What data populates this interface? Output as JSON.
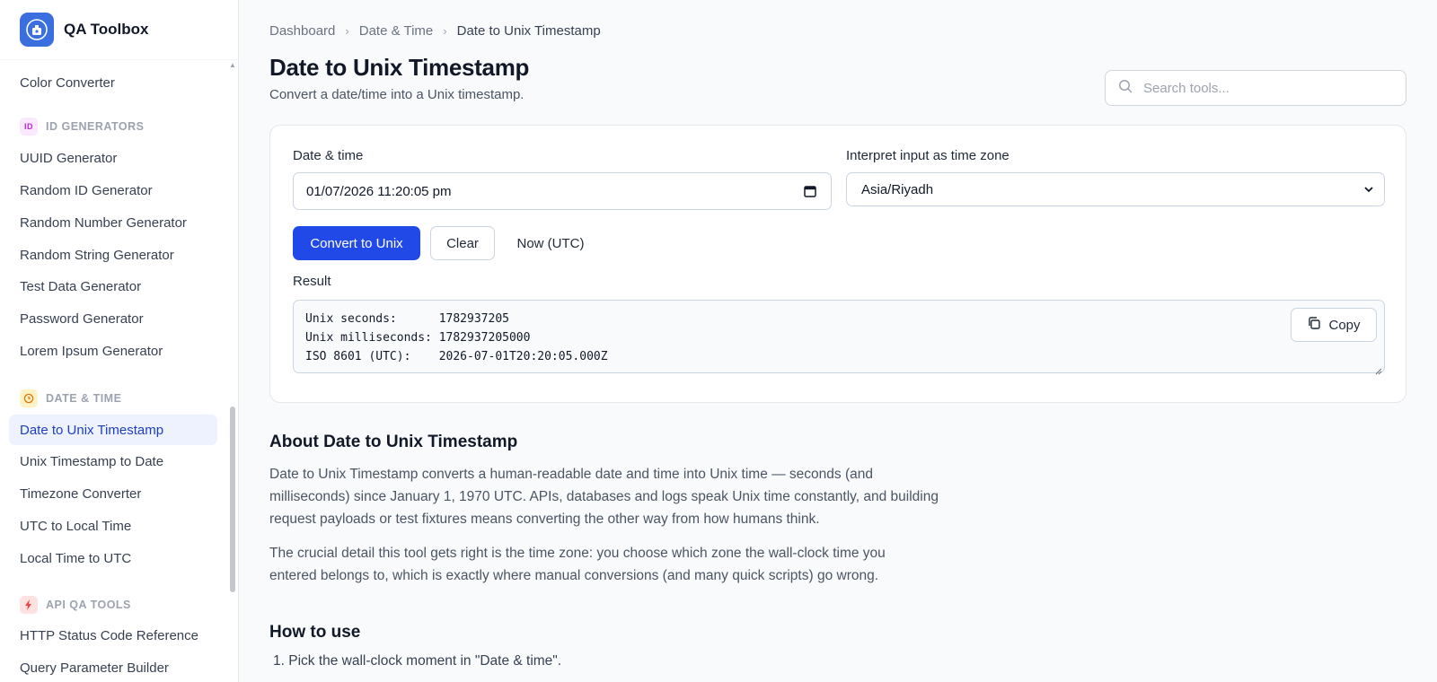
{
  "app": {
    "title": "QA Toolbox"
  },
  "sidebar": {
    "top_items": [
      {
        "label": "Color Converter"
      }
    ],
    "groups": [
      {
        "label": "ID GENERATORS",
        "icon_text": "ID",
        "icon_color": "#c026d3",
        "items": [
          {
            "label": "UUID Generator"
          },
          {
            "label": "Random ID Generator"
          },
          {
            "label": "Random Number Generator"
          },
          {
            "label": "Random String Generator"
          },
          {
            "label": "Test Data Generator"
          },
          {
            "label": "Password Generator"
          },
          {
            "label": "Lorem Ipsum Generator"
          }
        ]
      },
      {
        "label": "DATE & TIME",
        "icon": "clock-icon",
        "icon_color": "#d97706",
        "items": [
          {
            "label": "Date to Unix Timestamp",
            "active": true
          },
          {
            "label": "Unix Timestamp to Date"
          },
          {
            "label": "Timezone Converter"
          },
          {
            "label": "UTC to Local Time"
          },
          {
            "label": "Local Time to UTC"
          }
        ]
      },
      {
        "label": "API QA TOOLS",
        "icon": "bolt-icon",
        "icon_color": "#ef4444",
        "items": [
          {
            "label": "HTTP Status Code Reference"
          },
          {
            "label": "Query Parameter Builder"
          }
        ]
      }
    ]
  },
  "breadcrumb": {
    "items": [
      "Dashboard",
      "Date & Time",
      "Date to Unix Timestamp"
    ]
  },
  "page": {
    "title": "Date to Unix Timestamp",
    "subtitle": "Convert a date/time into a Unix timestamp."
  },
  "search": {
    "placeholder": "Search tools...",
    "value": ""
  },
  "form": {
    "date_label": "Date & time",
    "date_value": "01/07/2026 11:20:05 pm",
    "tz_label": "Interpret input as time zone",
    "tz_value": "Asia/Riyadh",
    "convert_label": "Convert to Unix",
    "clear_label": "Clear",
    "now_label": "Now (UTC)",
    "result_label": "Result",
    "result_lines": [
      "Unix seconds:      1782937205",
      "Unix milliseconds: 1782937205000",
      "ISO 8601 (UTC):    2026-07-01T20:20:05.000Z"
    ],
    "copy_label": "Copy"
  },
  "about": {
    "title": "About Date to Unix Timestamp",
    "p1_lines": [
      "Date to Unix Timestamp converts a human-readable date and time into Unix time — seconds (and",
      "milliseconds) since January 1, 1970 UTC. APIs, databases and logs speak Unix time constantly, and building",
      "request payloads or test fixtures means converting the other way from how humans think."
    ],
    "p2_lines": [
      "The crucial detail this tool gets right is the time zone: you choose which zone the wall-clock time you",
      "entered belongs to, which is exactly where manual conversions (and many quick scripts) go wrong."
    ]
  },
  "howto": {
    "title": "How to use",
    "steps": [
      "1. Pick the wall-clock moment in \"Date & time\"."
    ]
  },
  "colors": {
    "accent": "#2149e8",
    "active_bg": "#eef2ff",
    "active_text": "#1e3fbf"
  }
}
